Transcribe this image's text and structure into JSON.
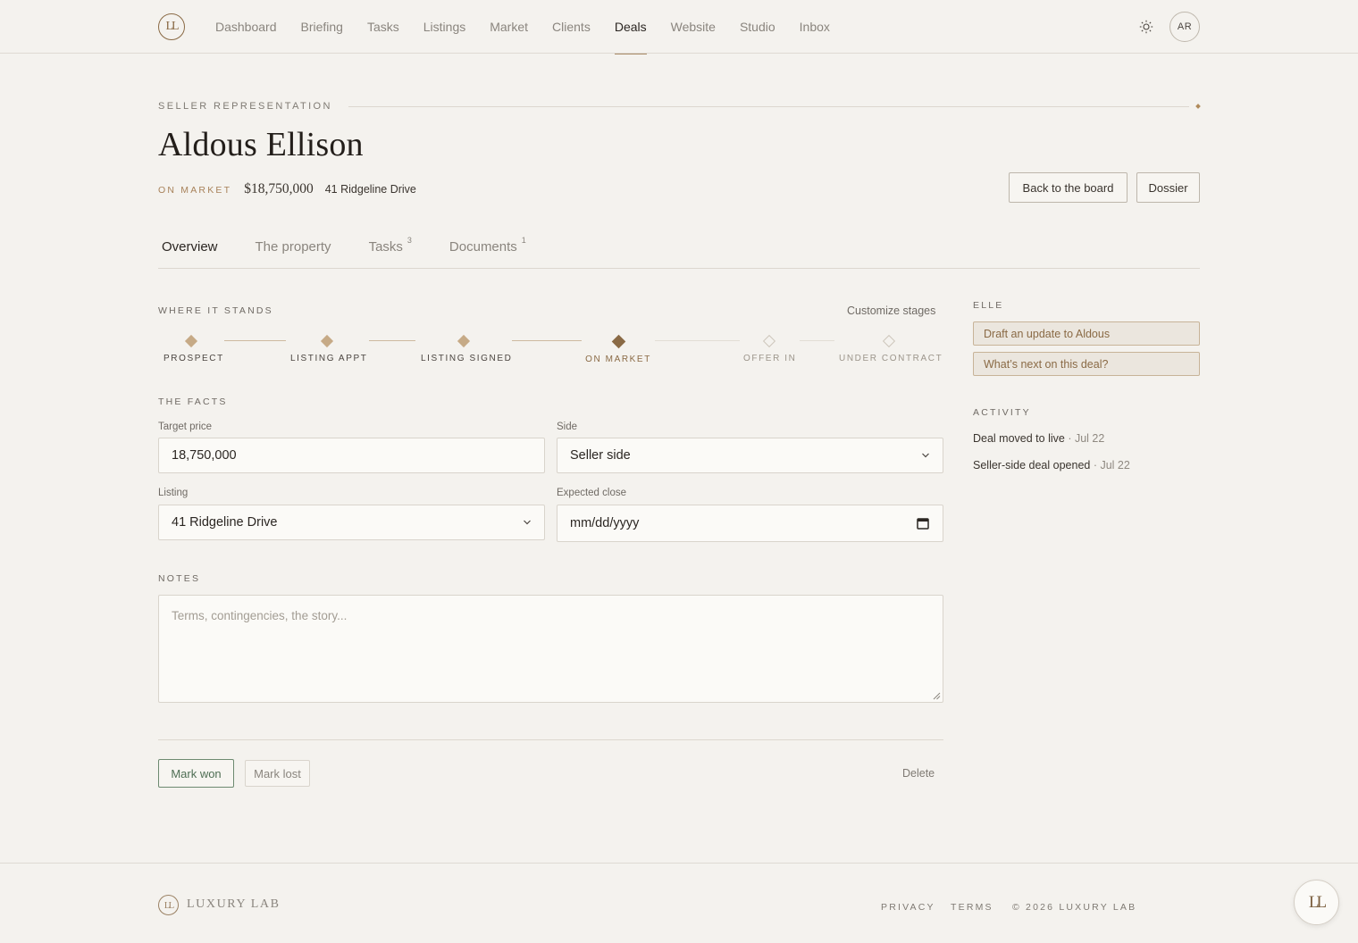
{
  "brand": {
    "logo_mark": "LL",
    "name": "LUXURY LAB"
  },
  "nav": {
    "items": [
      "Dashboard",
      "Briefing",
      "Tasks",
      "Listings",
      "Market",
      "Clients",
      "Deals",
      "Website",
      "Studio",
      "Inbox"
    ],
    "active": "Deals",
    "theme_icon": "sun-icon",
    "avatar_initials": "AR"
  },
  "header": {
    "eyebrow": "SELLER REPRESENTATION",
    "title": "Aldous Ellison",
    "status": "ON MARKET",
    "price": "$18,750,000",
    "address": "41 Ridgeline Drive",
    "back_label": "Back to the board",
    "dossier_label": "Dossier"
  },
  "tabs": [
    {
      "label": "Overview",
      "count": ""
    },
    {
      "label": "The property",
      "count": ""
    },
    {
      "label": "Tasks",
      "count": "3"
    },
    {
      "label": "Documents",
      "count": "1"
    }
  ],
  "stages": {
    "heading": "WHERE IT STANDS",
    "customize_label": "Customize stages",
    "items": [
      {
        "label": "PROSPECT",
        "state": "done"
      },
      {
        "label": "LISTING APPT",
        "state": "done"
      },
      {
        "label": "LISTING SIGNED",
        "state": "done"
      },
      {
        "label": "ON MARKET",
        "state": "current"
      },
      {
        "label": "OFFER IN",
        "state": "future"
      },
      {
        "label": "UNDER CONTRACT",
        "state": "future"
      }
    ]
  },
  "facts": {
    "heading": "THE FACTS",
    "target_price_label": "Target price",
    "target_price_value": "18,750,000",
    "side_label": "Side",
    "side_value": "Seller side",
    "listing_label": "Listing",
    "listing_value": "41 Ridgeline Drive",
    "close_label": "Expected close",
    "close_placeholder": "mm/dd/yyyy"
  },
  "notes": {
    "heading": "NOTES",
    "placeholder": "Terms, contingencies, the story..."
  },
  "actions": {
    "won_label": "Mark won",
    "lost_label": "Mark lost",
    "delete_label": "Delete"
  },
  "elle": {
    "heading": "ELLE",
    "prompts": [
      "Draft an update to Aldous",
      "What’s next on this deal?"
    ]
  },
  "activity": {
    "heading": "ACTIVITY",
    "items": [
      {
        "text": "Deal moved to live",
        "date": "· Jul 22"
      },
      {
        "text": "Seller-side deal opened",
        "date": "· Jul 22"
      }
    ]
  },
  "footer": {
    "privacy": "PRIVACY",
    "terms": "TERMS",
    "copyright": "© 2026 LUXURY LAB"
  },
  "colors": {
    "accent": "#8a6a45",
    "won": "#4f6e54",
    "background": "#f4f2ee"
  }
}
